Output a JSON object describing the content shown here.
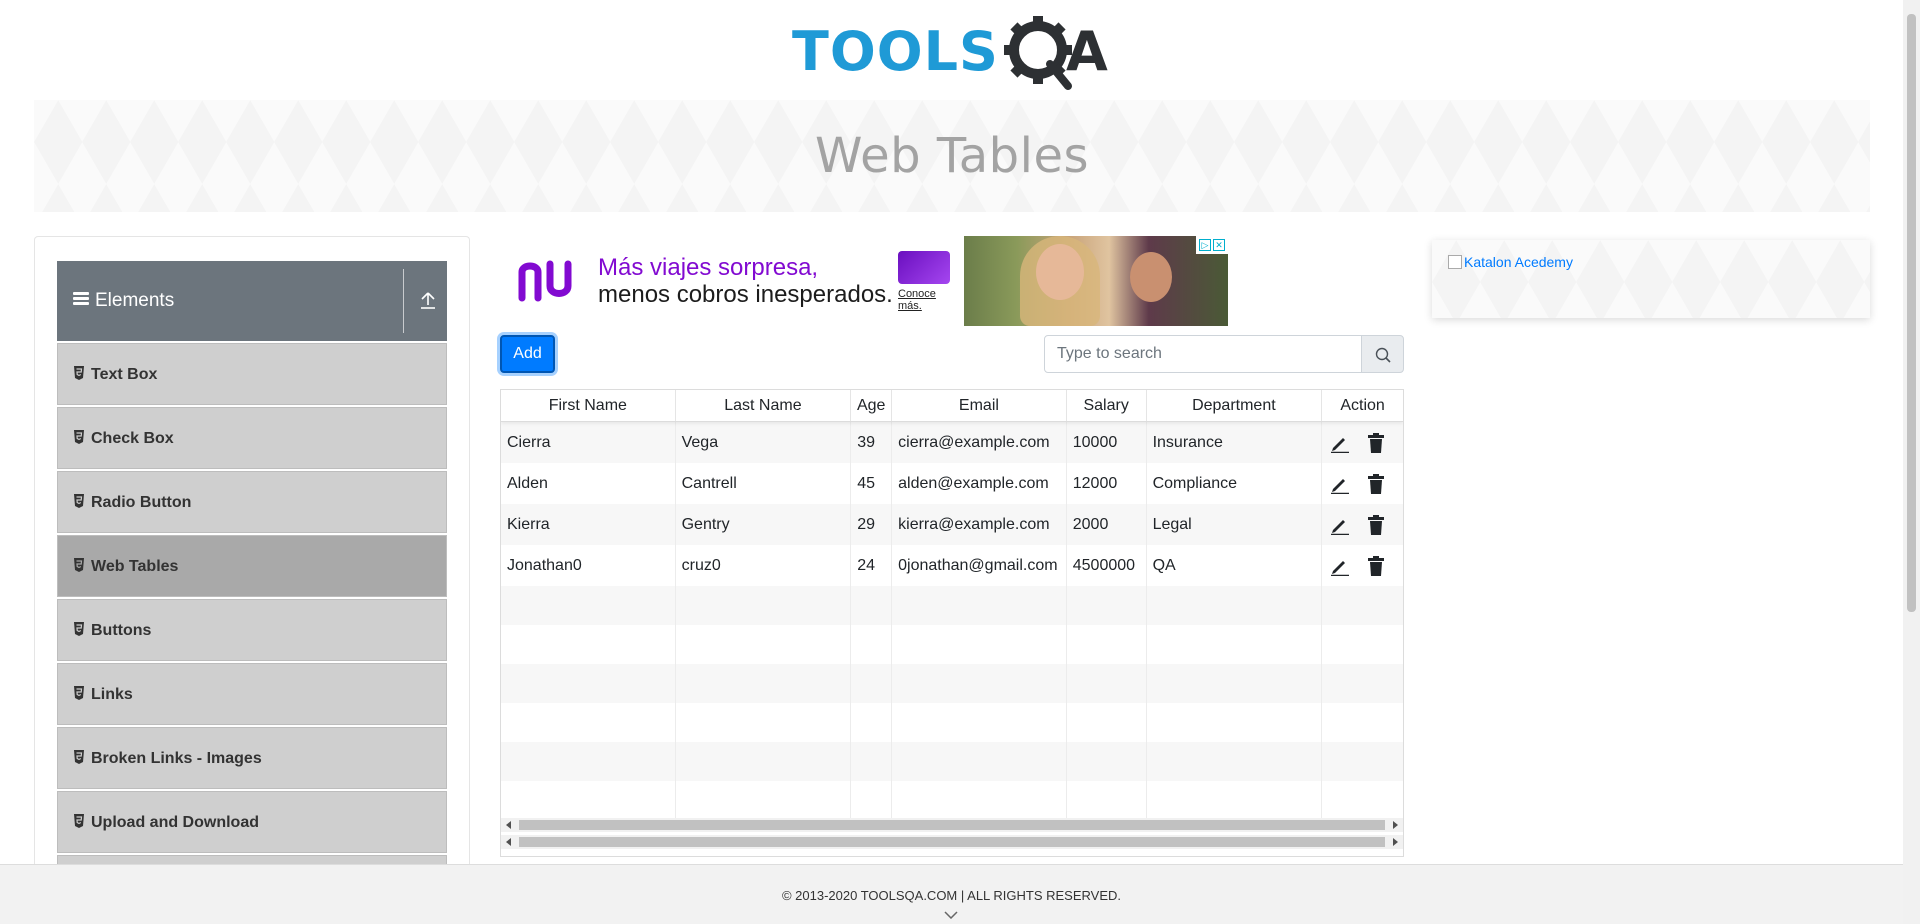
{
  "brand": {
    "logo_text": "TOOLSQA"
  },
  "banner": {
    "title": "Web Tables"
  },
  "sidebar": {
    "group_label": "Elements",
    "items": [
      {
        "label": "Text Box",
        "active": false
      },
      {
        "label": "Check Box",
        "active": false
      },
      {
        "label": "Radio Button",
        "active": false
      },
      {
        "label": "Web Tables",
        "active": true
      },
      {
        "label": "Buttons",
        "active": false
      },
      {
        "label": "Links",
        "active": false
      },
      {
        "label": "Broken Links - Images",
        "active": false
      },
      {
        "label": "Upload and Download",
        "active": false
      }
    ]
  },
  "ad": {
    "brand": "nu",
    "line1": "Más viajes sorpresa,",
    "line2": "menos cobros inesperados.",
    "cta": "Conoce más."
  },
  "toolbar": {
    "add_label": "Add",
    "search_placeholder": "Type to search"
  },
  "table": {
    "columns": [
      "First Name",
      "Last Name",
      "Age",
      "Email",
      "Salary",
      "Department",
      "Action"
    ],
    "rows": [
      [
        "Cierra",
        "Vega",
        "39",
        "cierra@example.com",
        "10000",
        "Insurance"
      ],
      [
        "Alden",
        "Cantrell",
        "45",
        "alden@example.com",
        "12000",
        "Compliance"
      ],
      [
        "Kierra",
        "Gentry",
        "29",
        "kierra@example.com",
        "2000",
        "Legal"
      ],
      [
        "Jonathan0",
        "cruz0",
        "24",
        "0jonathan@gmail.com",
        "4500000",
        "QA"
      ]
    ]
  },
  "right_ad": {
    "alt_text": "Katalon Acedemy"
  },
  "footer": {
    "copyright": "© 2013-2020 TOOLSQA.COM | ALL RIGHTS RESERVED."
  },
  "colors": {
    "accent": "#007bff",
    "sidebar_header": "#6c757d",
    "logo_blue": "#1f9ad6",
    "logo_dark": "#2d3033"
  }
}
